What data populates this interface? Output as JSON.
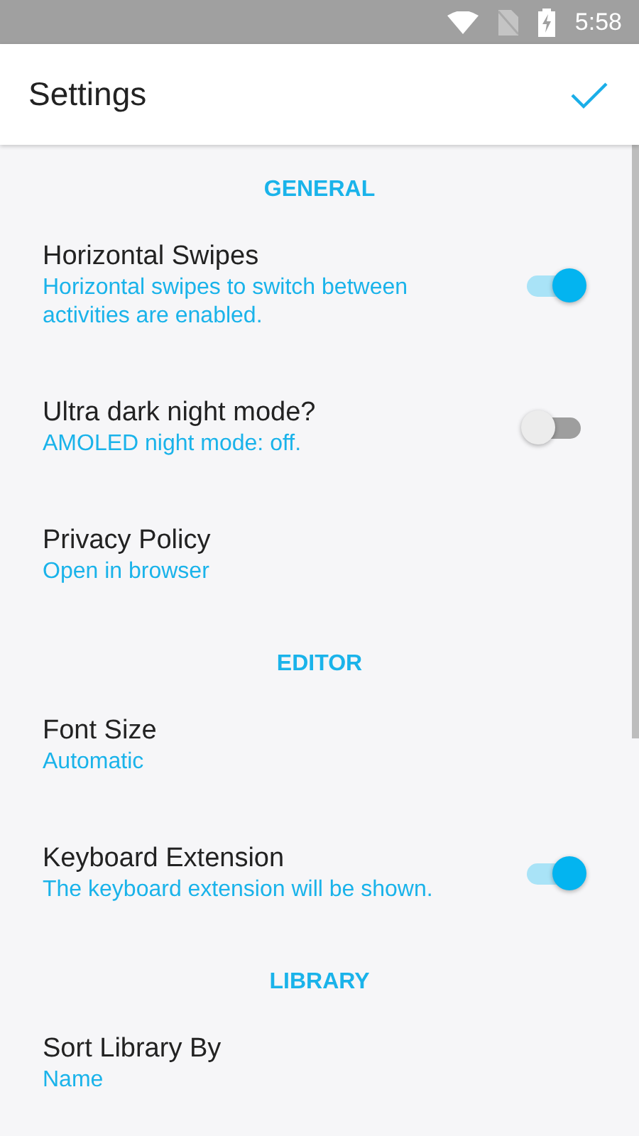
{
  "status_bar": {
    "time": "5:58"
  },
  "app_bar": {
    "title": "Settings"
  },
  "sections": [
    {
      "title": "GENERAL",
      "items": [
        {
          "kind": "switch",
          "title": "Horizontal Swipes",
          "summary": "Horizontal swipes to switch between activities are enabled.",
          "on": true
        },
        {
          "kind": "switch",
          "title": "Ultra dark night mode?",
          "summary": "AMOLED night mode: off.",
          "on": false
        },
        {
          "kind": "plain",
          "title": "Privacy Policy",
          "summary": "Open in browser"
        }
      ]
    },
    {
      "title": "EDITOR",
      "items": [
        {
          "kind": "plain",
          "title": "Font Size",
          "summary": "Automatic"
        },
        {
          "kind": "switch",
          "title": "Keyboard Extension",
          "summary": "The keyboard extension will be shown.",
          "on": true
        }
      ]
    },
    {
      "title": "LIBRARY",
      "items": [
        {
          "kind": "plain",
          "title": "Sort Library By",
          "summary": "Name"
        }
      ]
    }
  ]
}
